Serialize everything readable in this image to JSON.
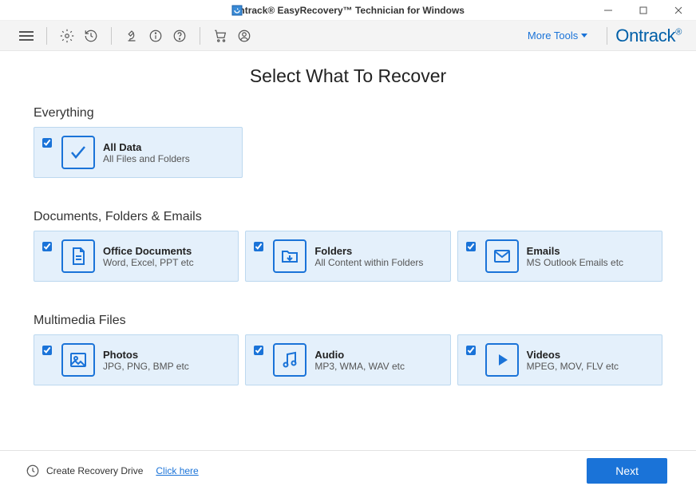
{
  "title_bar": {
    "text": "Ontrack® EasyRecovery™ Technician for Windows"
  },
  "toolbar": {
    "more_tools": "More Tools",
    "brand": "Ontrack"
  },
  "page": {
    "heading": "Select What To Recover"
  },
  "sections": {
    "everything": {
      "title": "Everything",
      "cards": [
        {
          "title": "All Data",
          "sub": "All Files and Folders"
        }
      ]
    },
    "documents": {
      "title": "Documents, Folders & Emails",
      "cards": [
        {
          "title": "Office Documents",
          "sub": "Word, Excel, PPT etc"
        },
        {
          "title": "Folders",
          "sub": "All Content within Folders"
        },
        {
          "title": "Emails",
          "sub": "MS Outlook Emails etc"
        }
      ]
    },
    "multimedia": {
      "title": "Multimedia Files",
      "cards": [
        {
          "title": "Photos",
          "sub": "JPG, PNG, BMP etc"
        },
        {
          "title": "Audio",
          "sub": "MP3, WMA, WAV etc"
        },
        {
          "title": "Videos",
          "sub": "MPEG, MOV, FLV etc"
        }
      ]
    }
  },
  "footer": {
    "create_drive": "Create Recovery Drive",
    "click_here": "Click here",
    "next": "Next"
  }
}
